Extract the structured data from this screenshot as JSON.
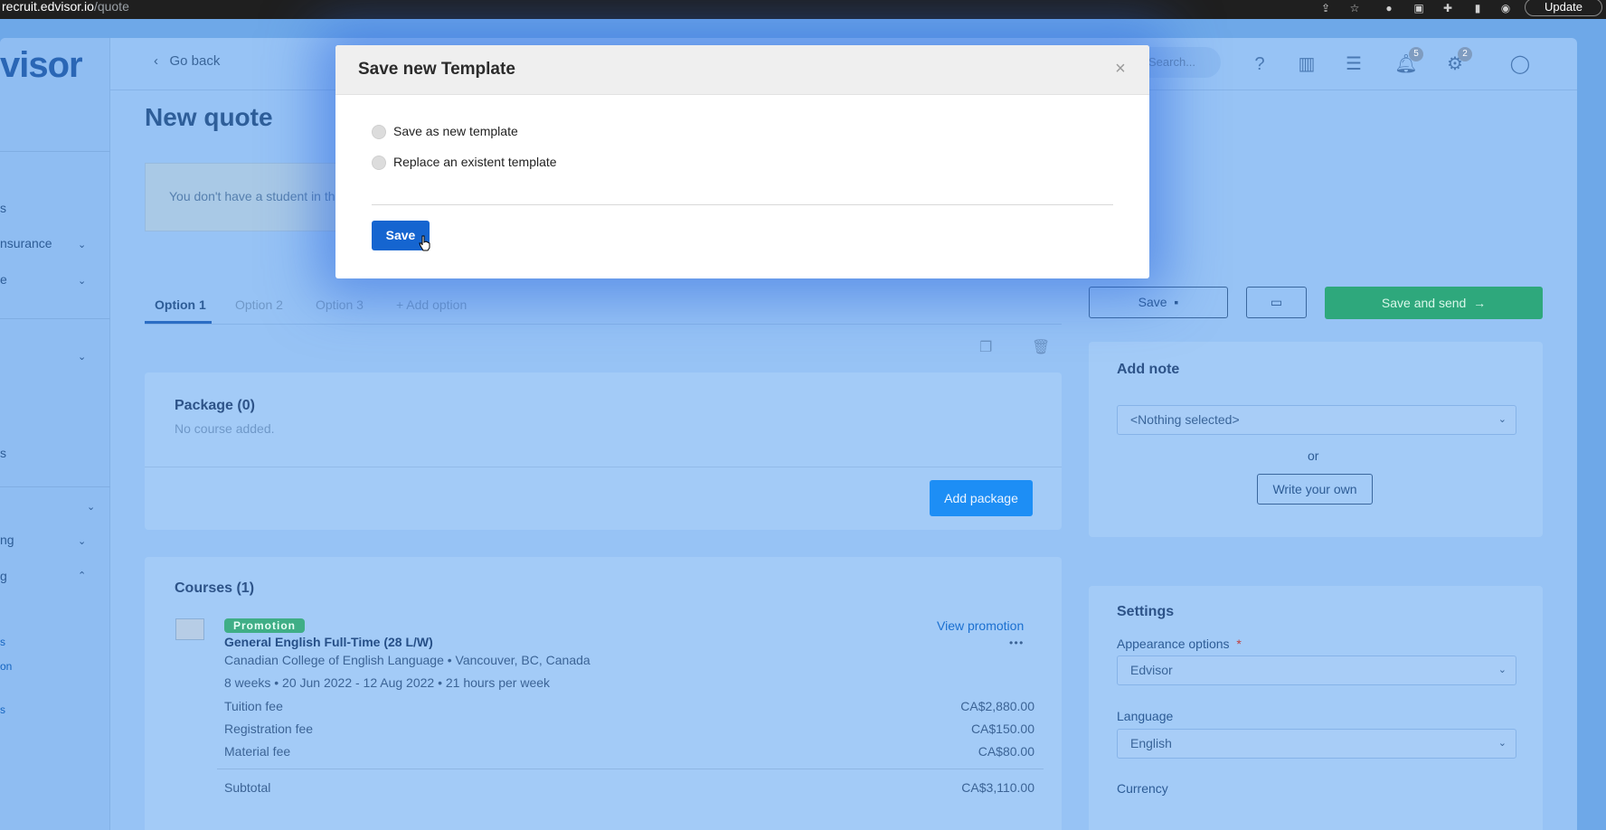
{
  "browser": {
    "url_host": "recruit.edvisor.io",
    "url_path": "/quote",
    "update_label": "Update"
  },
  "app": {
    "logo_text": "visor",
    "go_back": "Go back",
    "search_placeholder": "Search...",
    "notifications_count": "5",
    "settings_count": "2",
    "page_title": "New quote",
    "alert_text": "You don't have a student in th",
    "sidebar": {
      "items": [
        {
          "label": "s"
        },
        {
          "label": "nsurance"
        },
        {
          "label": "e"
        },
        {
          "label": "s"
        },
        {
          "label": "ng"
        },
        {
          "label": "g"
        }
      ],
      "links": [
        "s",
        "on",
        "s"
      ]
    },
    "tabs": [
      "Option 1",
      "Option 2",
      "Option 3",
      "+ Add option"
    ],
    "package": {
      "title": "Package (0)",
      "empty": "No course added.",
      "add_button": "Add package"
    },
    "courses": {
      "title": "Courses (1)",
      "promo_badge": "Promotion",
      "view_promotion": "View promotion",
      "more": "• • •",
      "course_name": "General English Full-Time (28 L/W)",
      "school": "Canadian College of English Language • Vancouver, BC, Canada",
      "dates": "8 weeks • 20 Jun 2022 - 12 Aug 2022 • 21 hours per week",
      "fees": [
        {
          "label": "Tuition fee",
          "amount": "CA$2,880.00"
        },
        {
          "label": "Registration fee",
          "amount": "CA$150.00"
        },
        {
          "label": "Material fee",
          "amount": "CA$80.00"
        }
      ],
      "subtotal_label": "Subtotal",
      "subtotal_amount": "CA$3,110.00"
    },
    "actions": {
      "save": "Save",
      "save_and_send": "Save and send"
    },
    "note": {
      "title": "Add note",
      "select_value": "<Nothing selected>",
      "or": "or",
      "write_button": "Write your own"
    },
    "settings": {
      "title": "Settings",
      "appearance_label": "Appearance options",
      "required_mark": "*",
      "appearance_value": "Edvisor",
      "language_label": "Language",
      "language_value": "English",
      "currency_label": "Currency"
    }
  },
  "modal": {
    "title": "Save new Template",
    "close": "×",
    "options": [
      "Save as new template",
      "Replace an existent template"
    ],
    "save_button": "Save"
  }
}
